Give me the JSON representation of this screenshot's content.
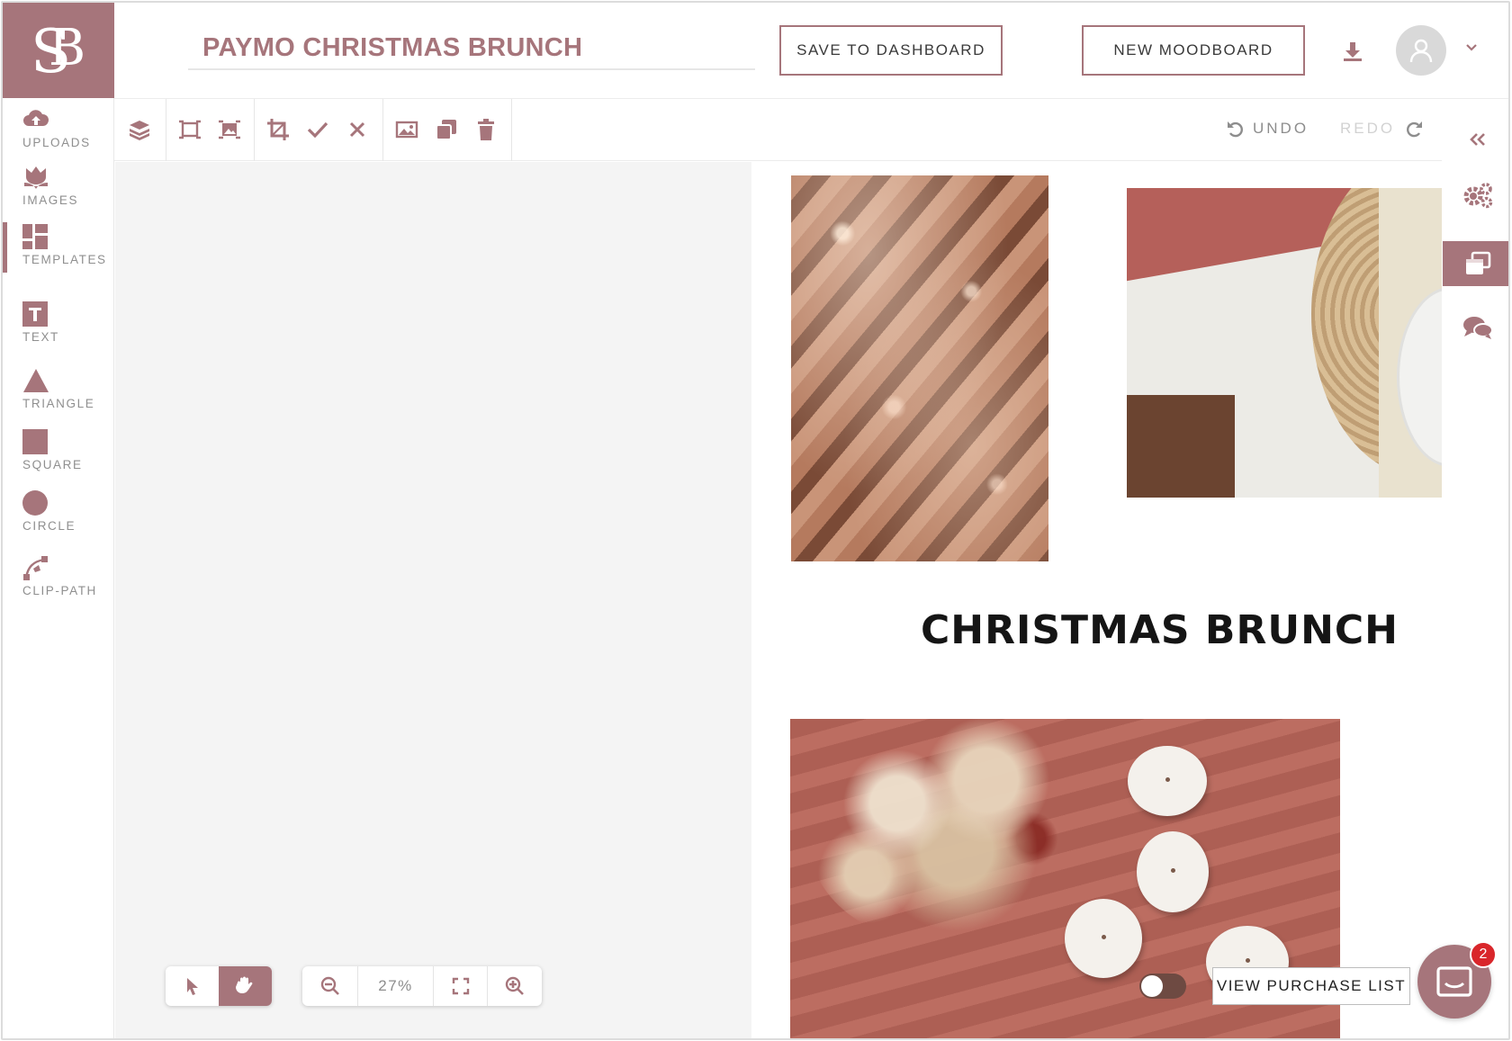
{
  "project": {
    "title": "PAYMO CHRISTMAS BRUNCH"
  },
  "header": {
    "save_label": "SAVE TO DASHBOARD",
    "new_label": "NEW MOODBOARD"
  },
  "sidebar": {
    "items": [
      {
        "label": "UPLOADS",
        "icon": "cloud-upload-icon"
      },
      {
        "label": "IMAGES",
        "icon": "tulip-icon"
      },
      {
        "label": "TEMPLATES",
        "icon": "grid-layout-icon",
        "active": true
      },
      {
        "label": "TEXT",
        "icon": "text-t-icon"
      },
      {
        "label": "TRIANGLE",
        "icon": "triangle-icon"
      },
      {
        "label": "SQUARE",
        "icon": "square-icon"
      },
      {
        "label": "CIRCLE",
        "icon": "circle-icon"
      },
      {
        "label": "CLIP-PATH",
        "icon": "bezier-pen-icon"
      }
    ]
  },
  "toolbar": {
    "undo_label": "UNDO",
    "redo_label": "REDO"
  },
  "board": {
    "heading": "CHRISTMAS BRUNCH",
    "purchase_label": "VIEW PURCHASE LIST"
  },
  "zoom": {
    "level": "27%"
  },
  "chat": {
    "badge_count": "2"
  },
  "colors": {
    "accent": "#a6757b",
    "badge": "#d9262b"
  }
}
